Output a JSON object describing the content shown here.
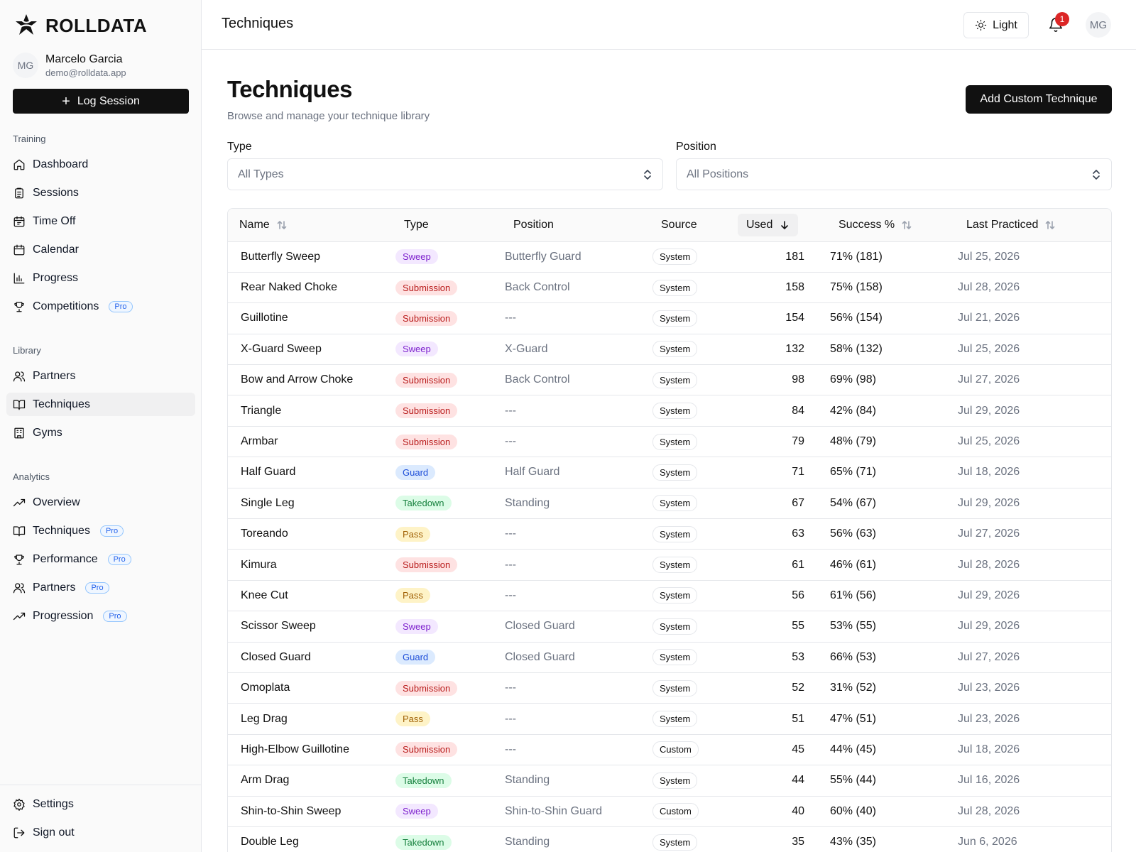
{
  "brand": {
    "name": "ROLLDATA"
  },
  "user": {
    "initials": "MG",
    "name": "Marcelo Garcia",
    "email": "demo@rolldata.app"
  },
  "log_session_label": "Log Session",
  "sections": {
    "training": {
      "label": "Training",
      "items": [
        {
          "label": "Dashboard",
          "icon": "home-icon"
        },
        {
          "label": "Sessions",
          "icon": "clipboard-icon"
        },
        {
          "label": "Time Off",
          "icon": "calendar-off-icon"
        },
        {
          "label": "Calendar",
          "icon": "calendar-icon"
        },
        {
          "label": "Progress",
          "icon": "bar-chart-icon"
        },
        {
          "label": "Competitions",
          "icon": "trophy-icon",
          "pro": "Pro"
        }
      ]
    },
    "library": {
      "label": "Library",
      "items": [
        {
          "label": "Partners",
          "icon": "users-icon"
        },
        {
          "label": "Techniques",
          "icon": "book-icon",
          "active": true
        },
        {
          "label": "Gyms",
          "icon": "building-icon"
        }
      ]
    },
    "analytics": {
      "label": "Analytics",
      "items": [
        {
          "label": "Overview",
          "icon": "trending-up-icon"
        },
        {
          "label": "Techniques",
          "icon": "book-icon",
          "pro": "Pro"
        },
        {
          "label": "Performance",
          "icon": "trophy-icon",
          "pro": "Pro"
        },
        {
          "label": "Partners",
          "icon": "users-icon",
          "pro": "Pro"
        },
        {
          "label": "Progression",
          "icon": "trending-up-icon",
          "pro": "Pro"
        }
      ]
    },
    "bottom": {
      "items": [
        {
          "label": "Settings",
          "icon": "gear-icon"
        },
        {
          "label": "Sign out",
          "icon": "sign-out-icon"
        }
      ]
    }
  },
  "topbar": {
    "title": "Techniques",
    "theme_label": "Light",
    "notification_count": "1",
    "avatar_initials": "MG"
  },
  "page": {
    "title": "Techniques",
    "subtitle": "Browse and manage your technique library",
    "add_button": "Add Custom Technique"
  },
  "filters": {
    "type": {
      "label": "Type",
      "value": "All Types"
    },
    "position": {
      "label": "Position",
      "value": "All Positions"
    }
  },
  "colors": {
    "Sweep": {
      "bg": "#f3e8ff",
      "fg": "#7e22ce"
    },
    "Submission": {
      "bg": "#fee2e2",
      "fg": "#b91c1c"
    },
    "Guard": {
      "bg": "#dbeafe",
      "fg": "#1d4ed8"
    },
    "Takedown": {
      "bg": "#dcfce7",
      "fg": "#15803d"
    },
    "Pass": {
      "bg": "#fef3c7",
      "fg": "#a16207"
    }
  },
  "table": {
    "columns": [
      "Name",
      "Type",
      "Position",
      "Source",
      "Used",
      "Success %",
      "Last Practiced"
    ],
    "rows": [
      [
        "Butterfly Sweep",
        "Sweep",
        "Butterfly Guard",
        "System",
        "181",
        "71% (181)",
        "Jul 25, 2026"
      ],
      [
        "Rear Naked Choke",
        "Submission",
        "Back Control",
        "System",
        "158",
        "75% (158)",
        "Jul 28, 2026"
      ],
      [
        "Guillotine",
        "Submission",
        "---",
        "System",
        "154",
        "56% (154)",
        "Jul 21, 2026"
      ],
      [
        "X-Guard Sweep",
        "Sweep",
        "X-Guard",
        "System",
        "132",
        "58% (132)",
        "Jul 25, 2026"
      ],
      [
        "Bow and Arrow Choke",
        "Submission",
        "Back Control",
        "System",
        "98",
        "69% (98)",
        "Jul 27, 2026"
      ],
      [
        "Triangle",
        "Submission",
        "---",
        "System",
        "84",
        "42% (84)",
        "Jul 29, 2026"
      ],
      [
        "Armbar",
        "Submission",
        "---",
        "System",
        "79",
        "48% (79)",
        "Jul 25, 2026"
      ],
      [
        "Half Guard",
        "Guard",
        "Half Guard",
        "System",
        "71",
        "65% (71)",
        "Jul 18, 2026"
      ],
      [
        "Single Leg",
        "Takedown",
        "Standing",
        "System",
        "67",
        "54% (67)",
        "Jul 29, 2026"
      ],
      [
        "Toreando",
        "Pass",
        "---",
        "System",
        "63",
        "56% (63)",
        "Jul 27, 2026"
      ],
      [
        "Kimura",
        "Submission",
        "---",
        "System",
        "61",
        "46% (61)",
        "Jul 28, 2026"
      ],
      [
        "Knee Cut",
        "Pass",
        "---",
        "System",
        "56",
        "61% (56)",
        "Jul 29, 2026"
      ],
      [
        "Scissor Sweep",
        "Sweep",
        "Closed Guard",
        "System",
        "55",
        "53% (55)",
        "Jul 29, 2026"
      ],
      [
        "Closed Guard",
        "Guard",
        "Closed Guard",
        "System",
        "53",
        "66% (53)",
        "Jul 27, 2026"
      ],
      [
        "Omoplata",
        "Submission",
        "---",
        "System",
        "52",
        "31% (52)",
        "Jul 23, 2026"
      ],
      [
        "Leg Drag",
        "Pass",
        "---",
        "System",
        "51",
        "47% (51)",
        "Jul 23, 2026"
      ],
      [
        "High-Elbow Guillotine",
        "Submission",
        "---",
        "Custom",
        "45",
        "44% (45)",
        "Jul 18, 2026"
      ],
      [
        "Arm Drag",
        "Takedown",
        "Standing",
        "System",
        "44",
        "55% (44)",
        "Jul 16, 2026"
      ],
      [
        "Shin-to-Shin Sweep",
        "Sweep",
        "Shin-to-Shin Guard",
        "Custom",
        "40",
        "60% (40)",
        "Jul 28, 2026"
      ],
      [
        "Double Leg",
        "Takedown",
        "Standing",
        "System",
        "35",
        "43% (35)",
        "Jun 6, 2026"
      ]
    ]
  }
}
